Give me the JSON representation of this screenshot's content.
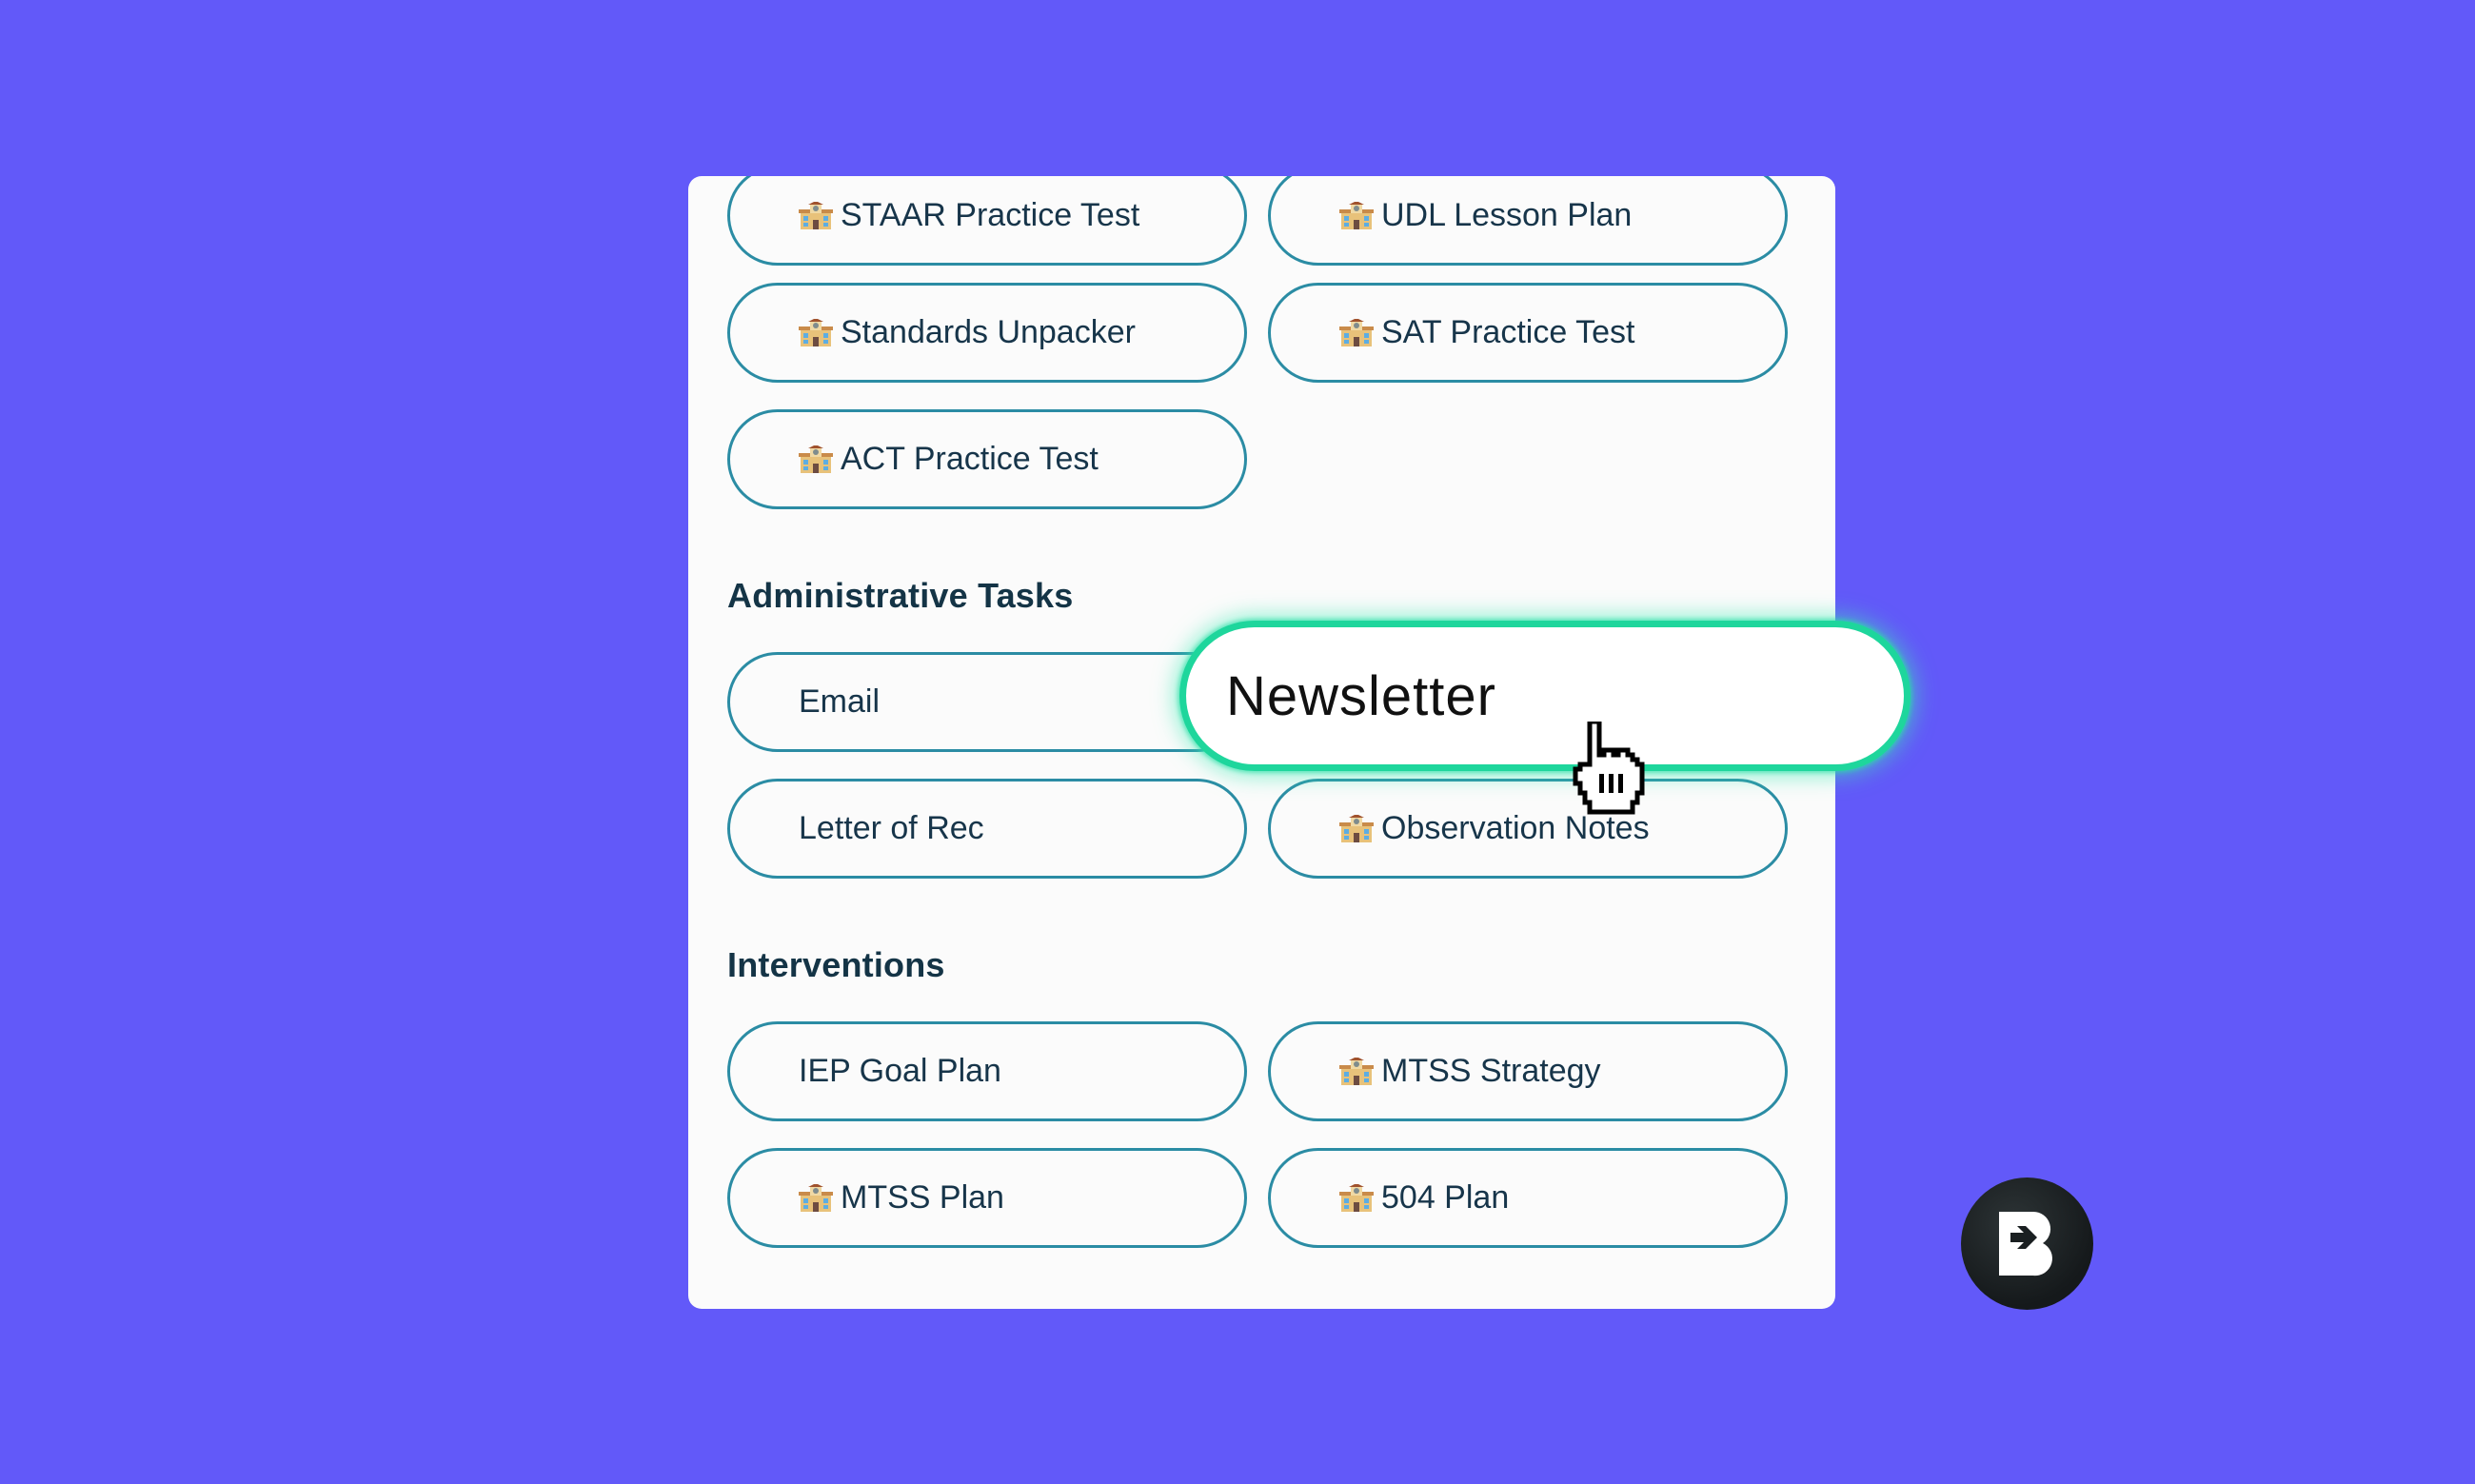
{
  "colors": {
    "background": "#6259f9",
    "panel": "#fbfbfb",
    "chip_border": "#2b8ca4",
    "chip_text": "#17354a",
    "heading_text": "#143446",
    "highlight_border": "#1ed69c"
  },
  "top_section": {
    "items": [
      {
        "label": "STAAR Practice Test",
        "icon": "school-building-icon"
      },
      {
        "label": "UDL Lesson Plan",
        "icon": "school-building-icon"
      },
      {
        "label": "Standards Unpacker",
        "icon": "school-building-icon"
      },
      {
        "label": "SAT Practice Test",
        "icon": "school-building-icon"
      },
      {
        "label": "ACT Practice Test",
        "icon": "school-building-icon"
      }
    ]
  },
  "administrative": {
    "title": "Administrative Tasks",
    "items": [
      {
        "label": "Email",
        "icon": null
      },
      {
        "label": "Letter of Rec",
        "icon": null
      },
      {
        "label": "Observation Notes",
        "icon": "school-building-icon"
      }
    ]
  },
  "interventions": {
    "title": "Interventions",
    "items": [
      {
        "label": "IEP Goal Plan",
        "icon": null
      },
      {
        "label": "MTSS Strategy",
        "icon": "school-building-icon"
      },
      {
        "label": "MTSS Plan",
        "icon": "school-building-icon"
      },
      {
        "label": "504 Plan",
        "icon": "school-building-icon"
      }
    ]
  },
  "highlight": {
    "label": "Newsletter",
    "cursor_icon": "hand-pointer-icon"
  },
  "brand": {
    "logo_icon": "brisk-logo-icon"
  }
}
